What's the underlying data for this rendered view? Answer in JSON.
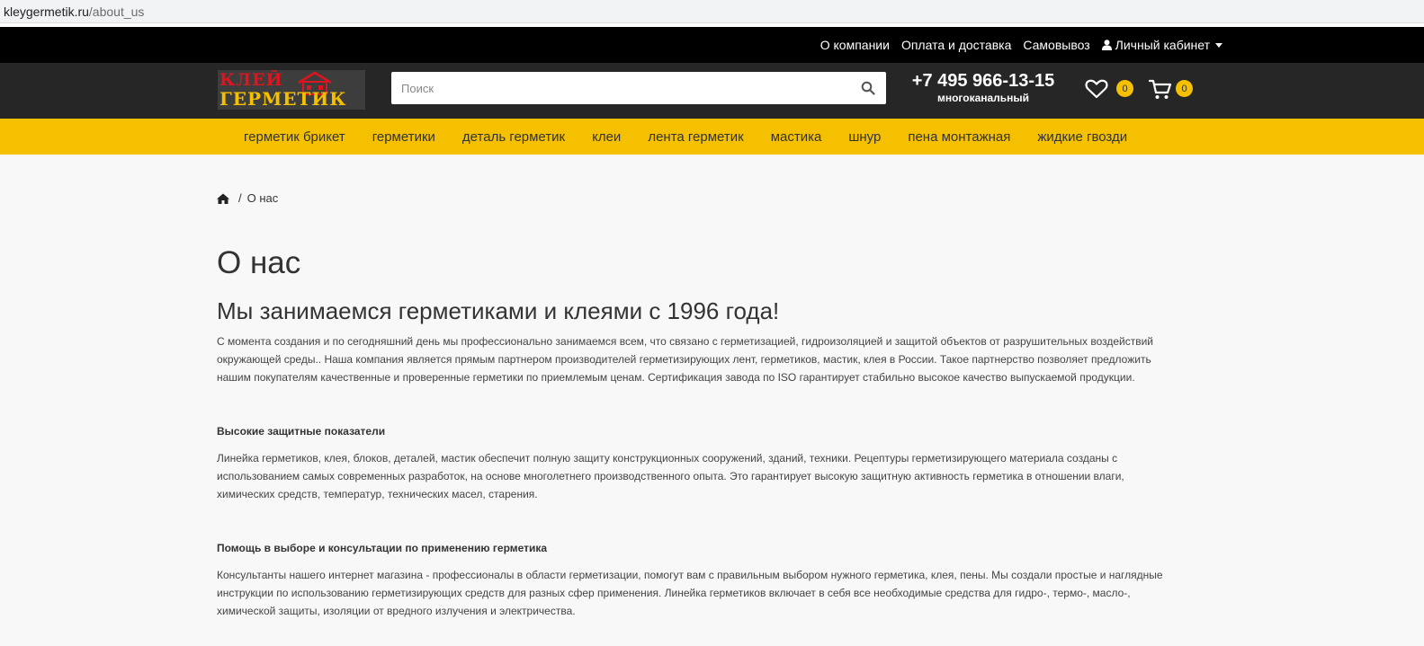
{
  "browser": {
    "url_domain": "kleygermetik.ru",
    "url_path": "/about_us"
  },
  "topbar": {
    "links": [
      "О компании",
      "Оплата и доставка",
      "Самовывоз"
    ],
    "account_label": "Личный кабинет"
  },
  "header": {
    "logo_line1": "КЛЕЙ",
    "logo_line2": "ГЕРМЕТИК",
    "search_placeholder": "Поиск",
    "phone": "+7 495 966-13-15",
    "phone_note": "многоканальный",
    "favorites_count": "0",
    "cart_count": "0"
  },
  "categories": [
    "герметик брикет",
    "герметики",
    "деталь герметик",
    "клеи",
    "лента герметик",
    "мастика",
    "шнур",
    "пена монтажная",
    "жидкие гвозди"
  ],
  "breadcrumb": {
    "current": "О нас"
  },
  "page": {
    "title": "О нас",
    "subtitle": "Мы занимаемся герметиками и клеями с 1996 года!",
    "intro": [
      "С момента создания и по сегодняшний день мы профессионально занимаемся всем, что связано с герметизацией, гидроизоляцией и защитой объектов от разрушительных воздействий",
      "окружающей среды.. Наша компания является прямым партнером производителей герметизирующих лент, герметиков, мастик, клея в России. Такое партнерство позволяет предложить",
      "нашим покупателям качественные и проверенные герметики по приемлемым ценам. Сертификация завода по ISO гарантирует стабильно высокое качество выпускаемой продукции."
    ],
    "section1_title": "Высокие защитные показатели",
    "section1_text": [
      "Линейка герметиков, клея, блоков, деталей, мастик  обеспечит полную защиту конструкционных сооружений, зданий, техники. Рецептуры герметизирующего материала созданы с",
      "использованием самых современных разработок, на основе многолетнего производственного опыта. Это гарантирует высокую защитную активность герметика в отношении влаги,",
      "химических средств, температур, технических масел, старения."
    ],
    "section2_title": "Помощь в выборе и консультации по применению герметика",
    "section2_text": [
      "Консультанты нашего интернет магазина - профессионалы в области герметизации, помогут вам с правильным выбором нужного герметика, клея, пены. Мы создали простые и наглядные",
      "инструкции по использованию герметизирующих средств для разных сфер применения. Линейка герметиков включает в себя все необходимые средства для гидро-, термо-, масло-,",
      "химической защиты, изоляции от вредного излучения и электричества."
    ]
  },
  "colors": {
    "topbar": "#000000",
    "header": "#262626",
    "accent": "#f5c000",
    "background": "#f8f8f8"
  }
}
